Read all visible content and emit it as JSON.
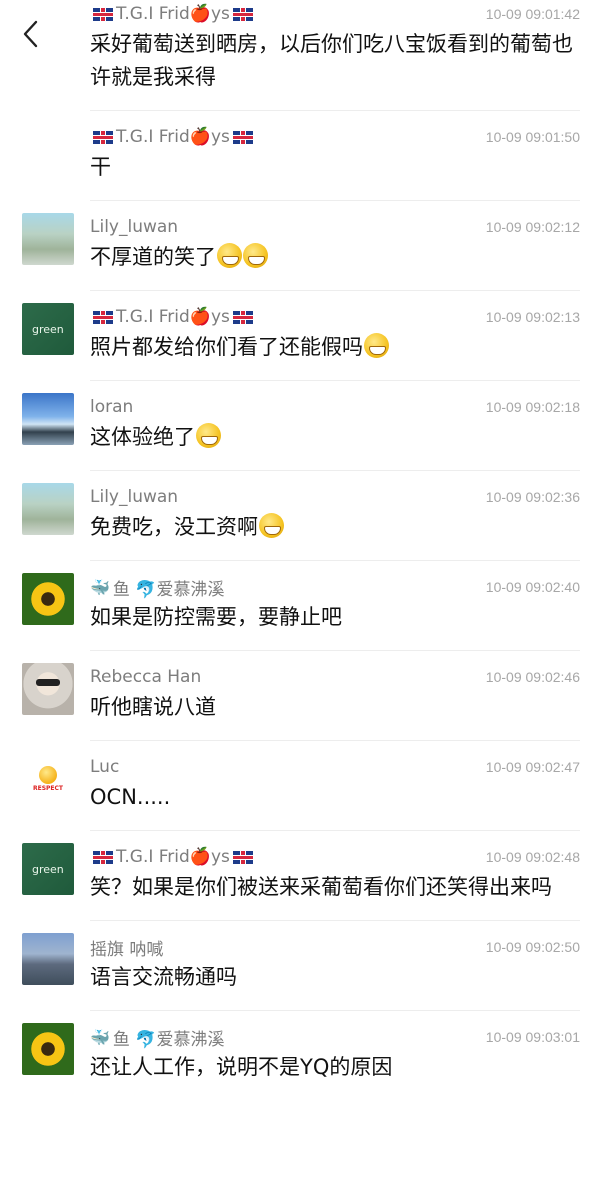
{
  "header": {
    "back_icon": "chevron-left-icon"
  },
  "messages": [
    {
      "name": "T.G.I Frid🍎ys",
      "flags": true,
      "avatar": "none",
      "time": "10-09 09:01:42",
      "text": "采好葡萄送到晒房，以后你们吃八宝饭看到的葡萄也许就是我采得"
    },
    {
      "name": "T.G.I Frid🍎ys",
      "flags": true,
      "avatar": "none",
      "time": "10-09 09:01:50",
      "text": "干"
    },
    {
      "name": "Lily_luwan",
      "flags": false,
      "avatar": "sea",
      "time": "10-09 09:02:12",
      "text": "不厚道的笑了",
      "emojis": 2
    },
    {
      "name": "T.G.I Frid🍎ys",
      "flags": true,
      "avatar": "green",
      "time": "10-09 09:02:13",
      "text": "照片都发给你们看了还能假吗",
      "emojis": 1
    },
    {
      "name": "loran",
      "flags": false,
      "avatar": "sky",
      "time": "10-09 09:02:18",
      "text": "这体验绝了",
      "emojis": 1
    },
    {
      "name": "Lily_luwan",
      "flags": false,
      "avatar": "sea",
      "time": "10-09 09:02:36",
      "text": "免费吃，没工资啊",
      "emojis": 1
    },
    {
      "name": "鱼 🐬爱慕沸溪",
      "flags": false,
      "whale": true,
      "avatar": "sun",
      "time": "10-09 09:02:40",
      "text": "如果是防控需要，要静止吧"
    },
    {
      "name": "Rebecca Han",
      "flags": false,
      "avatar": "woman",
      "time": "10-09 09:02:46",
      "text": "听他瞎说八道"
    },
    {
      "name": "Luc",
      "flags": false,
      "avatar": "respect",
      "time": "10-09 09:02:47",
      "text": "OCN....."
    },
    {
      "name": "T.G.I Frid🍎ys",
      "flags": true,
      "avatar": "green",
      "time": "10-09 09:02:48",
      "text": "笑？如果是你们被送来采葡萄看你们还笑得出来吗"
    },
    {
      "name": "摇旗 呐喊",
      "flags": false,
      "avatar": "city",
      "time": "10-09 09:02:50",
      "text": "语言交流畅通吗"
    },
    {
      "name": "鱼 🐬爱慕沸溪",
      "flags": false,
      "whale": true,
      "avatar": "sun",
      "time": "10-09 09:03:01",
      "text": "还让人工作，说明不是YQ的原因"
    }
  ],
  "respect_label": "RESPECT",
  "colors": {
    "name": "#7d7d7d",
    "time": "#a7a7a7",
    "text": "#111111",
    "divider": "#ededed"
  }
}
